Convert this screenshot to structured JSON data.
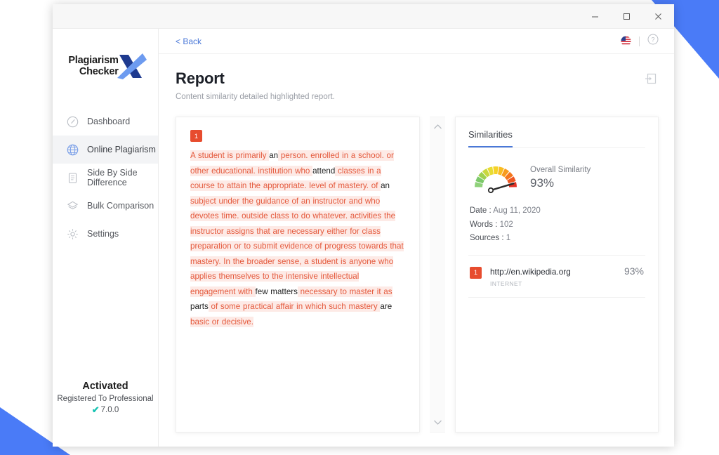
{
  "window": {
    "controls": [
      {
        "name": "minimize",
        "glyph": "minimize-icon"
      },
      {
        "name": "maximize",
        "glyph": "maximize-icon"
      },
      {
        "name": "close",
        "glyph": "close-icon"
      }
    ]
  },
  "sidebar": {
    "logo": {
      "line1": "Plagiarism",
      "line2": "Checker",
      "mark": "X"
    },
    "items": [
      {
        "label": "Dashboard",
        "icon": "gauge-icon",
        "active": false
      },
      {
        "label": "Online Plagiarism",
        "icon": "globe-icon",
        "active": true
      },
      {
        "label": "Side By Side Difference",
        "icon": "document-icon",
        "active": false
      },
      {
        "label": "Bulk Comparison",
        "icon": "layers-icon",
        "active": false
      },
      {
        "label": "Settings",
        "icon": "gear-icon",
        "active": false
      }
    ],
    "activation": {
      "title": "Activated",
      "subtitle": "Registered To Professional",
      "version": "7.0.0",
      "check": "✔"
    }
  },
  "topbar": {
    "back_label": "< Back",
    "flag_icon": "us-flag-icon",
    "help_icon": "help-circle-icon"
  },
  "page": {
    "title": "Report",
    "subtitle": "Content similarity detailed highlighted report.",
    "export_icon": "export-icon"
  },
  "report": {
    "badge": "1",
    "segments": [
      {
        "text": "A student is primarily ",
        "highlight": true
      },
      {
        "text": "an",
        "highlight": false
      },
      {
        "text": " person. enrolled in a school. or other educational. institution who ",
        "highlight": true
      },
      {
        "text": "attend",
        "highlight": false
      },
      {
        "text": " classes in a course to attain the appropriate. level of mastery. of ",
        "highlight": true
      },
      {
        "text": "an",
        "highlight": false
      },
      {
        "text": " subject under the guidance of an instructor and who devotes time. outside class to do whatever. activities the instructor assigns that are necessary either for class preparation or to submit evidence of progress towards that mastery. In the broader sense, a student is anyone who applies themselves to the intensive intellectual engagement with ",
        "highlight": true
      },
      {
        "text": "few matters",
        "highlight": false
      },
      {
        "text": " necessary to master it as ",
        "highlight": true
      },
      {
        "text": "parts",
        "highlight": false
      },
      {
        "text": " of some practical affair in which such mastery ",
        "highlight": true
      },
      {
        "text": "are",
        "highlight": false
      },
      {
        "text": " basic or decisive.",
        "highlight": true
      }
    ],
    "scroll_up_icon": "chevron-up-icon",
    "scroll_down_icon": "chevron-down-icon"
  },
  "similarities": {
    "tab_label": "Similarities",
    "gauge": {
      "label": "Overall Similarity",
      "value": "93%",
      "percent": 93,
      "segment_colors": [
        "#8fd17a",
        "#7cc96a",
        "#9ed04f",
        "#c9d83f",
        "#e8dc33",
        "#f5d228",
        "#f9bc22",
        "#f79b1f",
        "#f4761d",
        "#ef5722",
        "#e53125"
      ]
    },
    "meta": [
      {
        "label": "Date : ",
        "value": "Aug 11, 2020"
      },
      {
        "label": "Words : ",
        "value": "102"
      },
      {
        "label": "Sources : ",
        "value": "1"
      }
    ],
    "sources": [
      {
        "badge": "1",
        "url": "http://en.wikipedia.org",
        "type": "INTERNET",
        "percent": "93%"
      }
    ]
  },
  "colors": {
    "accent_blue": "#4a7bf7",
    "link_blue": "#4a78d8",
    "highlight_bg": "#fdeae6",
    "highlight_fg": "#e4593c",
    "badge_red": "#e74c2e",
    "check_teal": "#17c3b2"
  }
}
